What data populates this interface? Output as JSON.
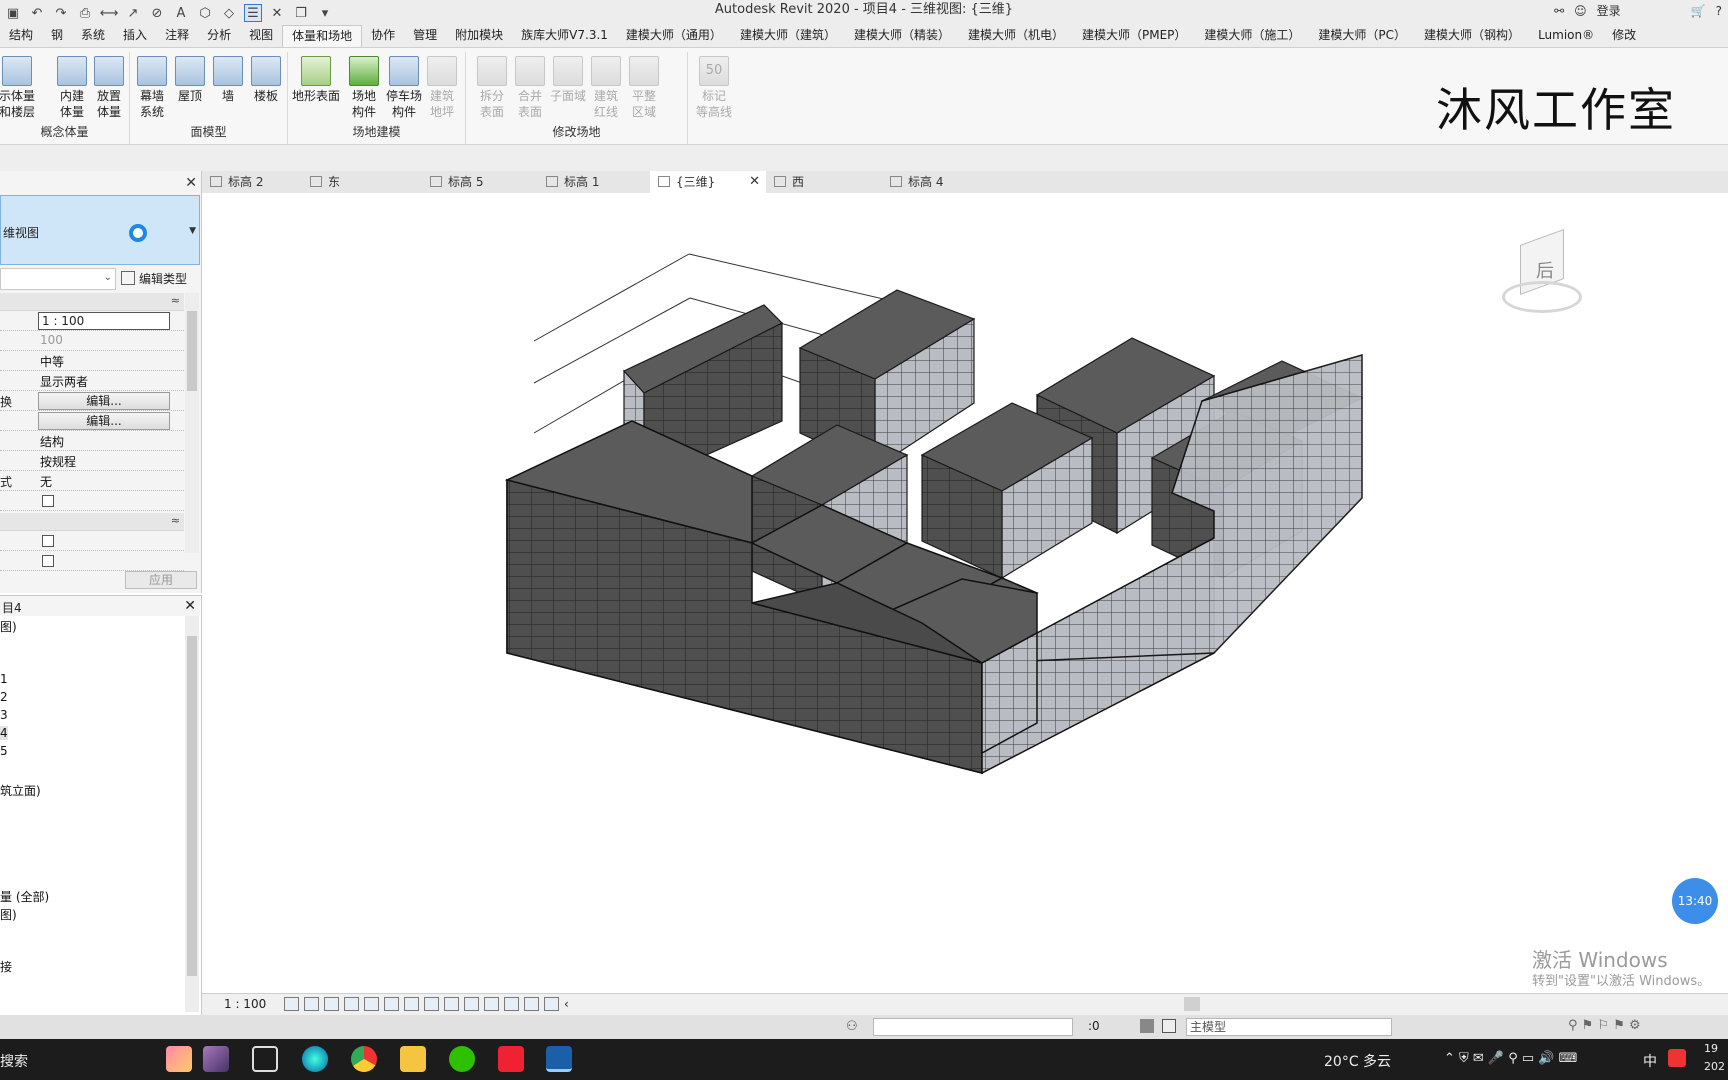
{
  "app": {
    "title": "Autodesk Revit 2020 - 项目4 - 三维视图: {三维}",
    "login": "登录"
  },
  "ribbon_tabs": [
    "结构",
    "钢",
    "系统",
    "插入",
    "注释",
    "分析",
    "视图",
    "体量和场地",
    "协作",
    "管理",
    "附加模块",
    "族库大师V7.3.1",
    "建模大师（通用）",
    "建模大师（建筑）",
    "建模大师（精装）",
    "建模大师（机电）",
    "建模大师（PMEP）",
    "建模大师（施工）",
    "建模大师（PC）",
    "建模大师（钢构）",
    "Lumion®",
    "修改"
  ],
  "ribbon": {
    "group_concept": "概念体量",
    "group_face": "面模型",
    "group_site": "场地建模",
    "group_modify": "修改场地",
    "buttons": {
      "show_mass": "示体量",
      "mass_floors": "和楼层",
      "inplace_mass_1": "内建",
      "inplace_mass_2": "体量",
      "place_mass_1": "放置",
      "place_mass_2": "体量",
      "curtain_1": "幕墙",
      "curtain_2": "系统",
      "roof": "屋顶",
      "wall": "墙",
      "floor": "楼板",
      "toposurface": "地形表面",
      "site_comp_1": "场地",
      "site_comp_2": "构件",
      "parking_1": "停车场",
      "parking_2": "构件",
      "building_pad_1": "建筑",
      "building_pad_2": "地坪",
      "split_1": "拆分",
      "split_2": "表面",
      "merge_1": "合并",
      "merge_2": "表面",
      "subregion": "子面域",
      "property_line_1": "建筑",
      "property_line_2": "红线",
      "graded_1": "平整",
      "graded_2": "区域",
      "label_contours_1": "标记",
      "label_contours_2": "等高线",
      "label_contours_num": "50"
    },
    "studio_text": "沐风工作室"
  },
  "properties": {
    "type_name": "维视图",
    "edit_type": "编辑类型",
    "rows": [
      {
        "k": "",
        "v": "1 : 100",
        "kind": "input"
      },
      {
        "k": "",
        "v": "100",
        "kind": "gray"
      },
      {
        "k": "",
        "v": "中等",
        "kind": "text"
      },
      {
        "k": "",
        "v": "显示两者",
        "kind": "text"
      },
      {
        "k": "换",
        "v": "编辑...",
        "kind": "button"
      },
      {
        "k": "",
        "v": "编辑...",
        "kind": "button"
      },
      {
        "k": "",
        "v": "结构",
        "kind": "text"
      },
      {
        "k": "",
        "v": "按规程",
        "kind": "text"
      },
      {
        "k": "式",
        "v": "无",
        "kind": "text"
      },
      {
        "k": "",
        "v": "",
        "kind": "check"
      }
    ],
    "rows2": [
      {
        "k": "",
        "v": "",
        "kind": "check"
      },
      {
        "k": "",
        "v": "",
        "kind": "check"
      }
    ],
    "apply": "应用"
  },
  "browser": {
    "title": "目4",
    "items": [
      {
        "label": "图)",
        "sel": false
      },
      {
        "label": "1",
        "sel": false
      },
      {
        "label": "2",
        "sel": false
      },
      {
        "label": "3",
        "sel": false
      },
      {
        "label": "4",
        "sel": true
      },
      {
        "label": "5",
        "sel": false
      },
      {
        "label": "筑立面)",
        "sel": false
      },
      {
        "label": "量 (全部)",
        "sel": false
      },
      {
        "label": "图)",
        "sel": false
      },
      {
        "label": "接",
        "sel": false
      }
    ]
  },
  "view_tabs": [
    {
      "label": "标高 2",
      "active": false
    },
    {
      "label": "东",
      "active": false
    },
    {
      "label": "标高 5",
      "active": false
    },
    {
      "label": "标高 1",
      "active": false
    },
    {
      "label": "{三维}",
      "active": true
    },
    {
      "label": "西",
      "active": false
    },
    {
      "label": "标高 4",
      "active": false
    }
  ],
  "viewbar": {
    "scale": "1 : 100"
  },
  "canvas": {
    "timer": "13:40",
    "activate_1": "激活 Windows",
    "activate_2": "转到\"设置\"以激活 Windows。",
    "nav_cube_face": "后"
  },
  "status": {
    "zero": ":0",
    "model": "主模型"
  },
  "taskbar": {
    "search": "搜索",
    "weather": "20°C  多云",
    "ime": "中",
    "clock_1": "19",
    "clock_2": "202"
  }
}
